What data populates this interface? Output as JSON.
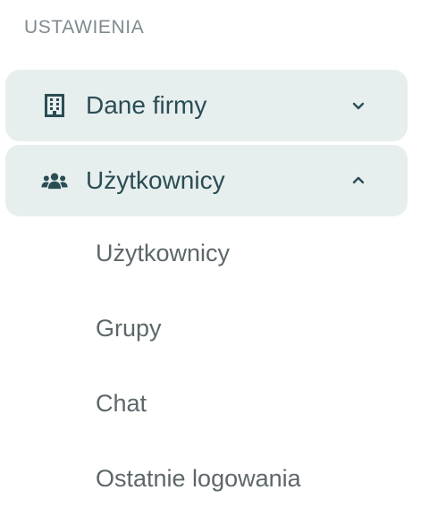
{
  "settings": {
    "section_title": "USTAWIENIA",
    "groups": [
      {
        "label": "Dane firmy",
        "icon": "building-icon",
        "expanded": false
      },
      {
        "label": "Użytkownicy",
        "icon": "users-icon",
        "expanded": true,
        "items": [
          {
            "label": "Użytkownicy"
          },
          {
            "label": "Grupy"
          },
          {
            "label": "Chat"
          },
          {
            "label": "Ostatnie logowania"
          }
        ]
      }
    ]
  },
  "colors": {
    "accent": "#2a4d54",
    "group_background": "#e7eeee",
    "muted_text": "#7f8a90",
    "item_text": "#5d6769"
  }
}
